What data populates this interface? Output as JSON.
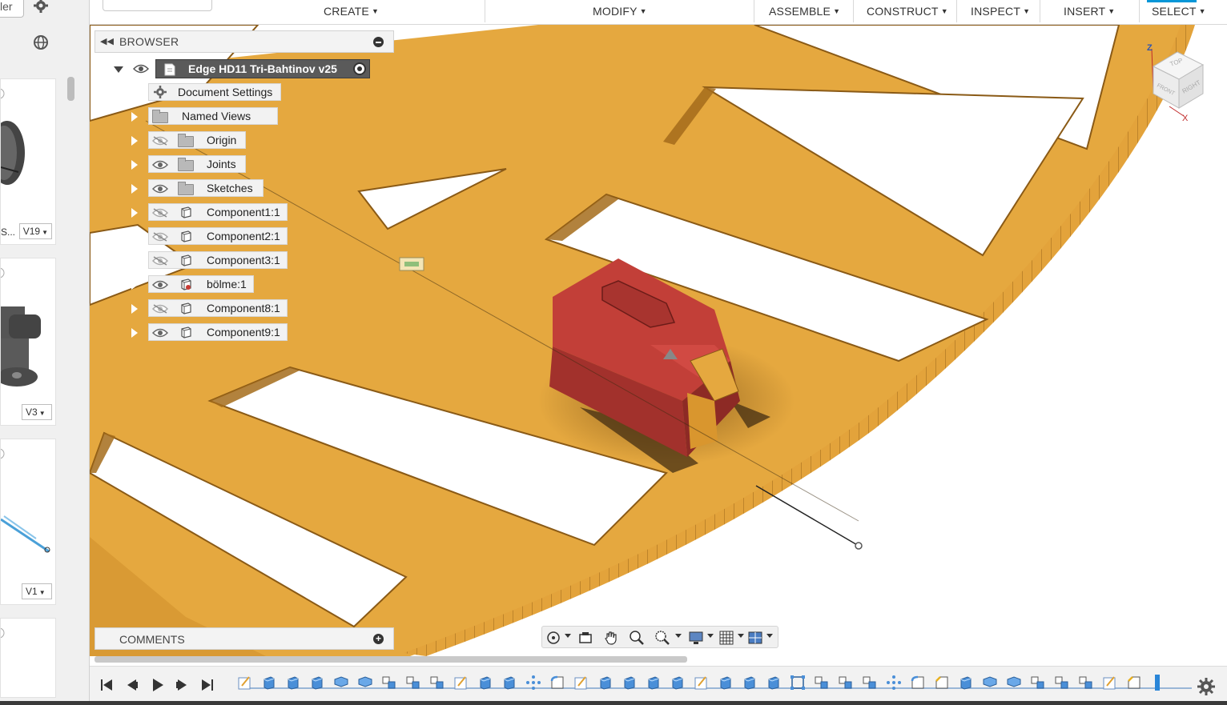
{
  "left_panel": {
    "folder_name": "ler",
    "items": [
      {
        "version": "V19",
        "name": "S..."
      },
      {
        "version": "V3"
      },
      {
        "version": "V1"
      },
      {}
    ]
  },
  "toolbar": {
    "menus": [
      "CREATE",
      "MODIFY",
      "ASSEMBLE",
      "CONSTRUCT",
      "INSPECT",
      "INSERT",
      "SELECT"
    ],
    "active": "SELECT"
  },
  "browser": {
    "title": "BROWSER",
    "root": "Edge HD11 Tri-Bahtinov v25",
    "nodes": [
      {
        "label": "Document Settings",
        "icon": "gear-icon",
        "eye": "none"
      },
      {
        "label": "Named Views",
        "icon": "folder-icon",
        "eye": "none"
      },
      {
        "label": "Origin",
        "icon": "folder-icon",
        "eye": "hidden"
      },
      {
        "label": "Joints",
        "icon": "folder-icon",
        "eye": "visible"
      },
      {
        "label": "Sketches",
        "icon": "folder-icon",
        "eye": "visible"
      },
      {
        "label": "Component1:1",
        "icon": "component-icon",
        "eye": "hidden"
      },
      {
        "label": "Component2:1",
        "icon": "component-icon",
        "eye": "hidden"
      },
      {
        "label": "Component3:1",
        "icon": "component-icon",
        "eye": "hidden"
      },
      {
        "label": "bölme:1",
        "icon": "component-active-icon",
        "eye": "visible"
      },
      {
        "label": "Component8:1",
        "icon": "component-icon",
        "eye": "hidden"
      },
      {
        "label": "Component9:1",
        "icon": "component-icon",
        "eye": "visible"
      }
    ]
  },
  "comments": {
    "title": "COMMENTS"
  },
  "viewcube": {
    "top": "TOP",
    "front": "FRONT",
    "right": "RIGHT",
    "axis_z": "Z",
    "axis_x": "X"
  },
  "colors": {
    "body": "#e5a83f",
    "body_dark": "#a66e1c",
    "red_part": "#b83a35",
    "accent": "#0696d7"
  }
}
